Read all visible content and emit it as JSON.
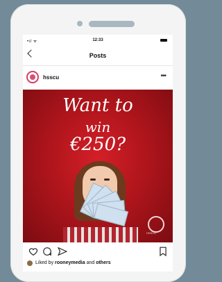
{
  "status_bar": {
    "signal_text": "•ıl ᯤ",
    "time": "12:33"
  },
  "nav": {
    "title": "Posts",
    "back_icon": "chevron-left-icon"
  },
  "post": {
    "username": "hsscu",
    "more_icon": "more-horizontal-icon",
    "image_text": {
      "line1": "Want to",
      "line2": "win",
      "line3": "€250?"
    },
    "logo_text": "HSSCU",
    "actions": {
      "like_icon": "heart-icon",
      "comment_icon": "comment-icon",
      "share_icon": "send-icon",
      "save_icon": "bookmark-icon"
    },
    "likes": {
      "prefix": "Liked by",
      "user": "rooneymedia",
      "middle": "and",
      "suffix": "others"
    }
  },
  "colors": {
    "background": "#738a98",
    "accent_red": "#c61a22",
    "avatar_ring": "#d93a68"
  }
}
